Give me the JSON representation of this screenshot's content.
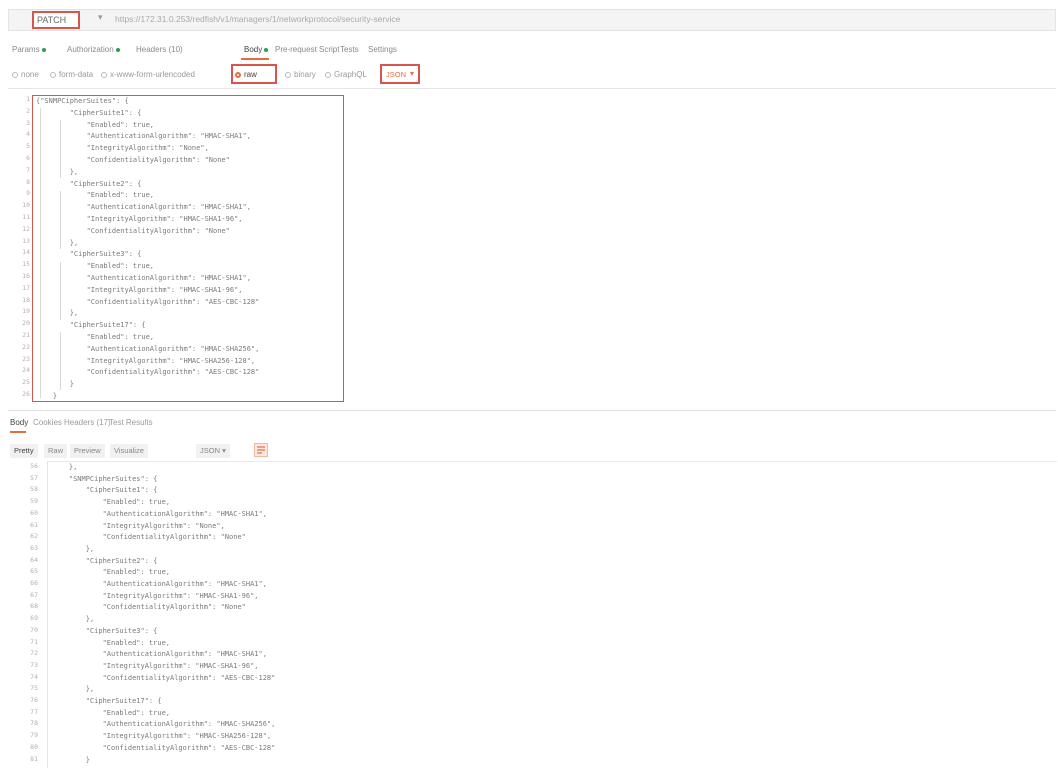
{
  "request": {
    "method": "PATCH",
    "url": "https://172.31.0.253/redfish/v1/managers/1/networkprotocol/security-service"
  },
  "tabs": [
    {
      "label": "Params",
      "dot": true
    },
    {
      "label": "Authorization",
      "dot": true
    },
    {
      "label": "Headers (10)",
      "dot": false
    },
    {
      "label": "Body",
      "dot": true,
      "active": true
    },
    {
      "label": "Pre-request Script",
      "dot": false
    },
    {
      "label": "Tests",
      "dot": false
    },
    {
      "label": "Settings",
      "dot": false
    }
  ],
  "body_options": [
    {
      "label": "none"
    },
    {
      "label": "form-data"
    },
    {
      "label": "x-www-form-urlencoded"
    },
    {
      "label": "raw",
      "selected": true
    },
    {
      "label": "binary"
    },
    {
      "label": "GraphQL"
    }
  ],
  "body_format": "JSON",
  "request_body": [
    "{\"SNMPCipherSuites\": {",
    "        \"CipherSuite1\": {",
    "            \"Enabled\": true,",
    "            \"AuthenticationAlgorithm\": \"HMAC-SHA1\",",
    "            \"IntegrityAlgorithm\": \"None\",",
    "            \"ConfidentialityAlgorithm\": \"None\"",
    "        },",
    "        \"CipherSuite2\": {",
    "            \"Enabled\": true,",
    "            \"AuthenticationAlgorithm\": \"HMAC-SHA1\",",
    "            \"IntegrityAlgorithm\": \"HMAC-SHA1-96\",",
    "            \"ConfidentialityAlgorithm\": \"None\"",
    "        },",
    "        \"CipherSuite3\": {",
    "            \"Enabled\": true,",
    "            \"AuthenticationAlgorithm\": \"HMAC-SHA1\",",
    "            \"IntegrityAlgorithm\": \"HMAC-SHA1-96\",",
    "            \"ConfidentialityAlgorithm\": \"AES-CBC-128\"",
    "        },",
    "        \"CipherSuite17\": {",
    "            \"Enabled\": true,",
    "            \"AuthenticationAlgorithm\": \"HMAC-SHA256\",",
    "            \"IntegrityAlgorithm\": \"HMAC-SHA256-128\",",
    "            \"ConfidentialityAlgorithm\": \"AES-CBC-128\"",
    "        }",
    "    }"
  ],
  "request_line_numbers": [
    "1",
    "2",
    "3",
    "4",
    "5",
    "6",
    "7",
    "8",
    "9",
    "10",
    "11",
    "12",
    "13",
    "14",
    "15",
    "16",
    "17",
    "18",
    "19",
    "20",
    "21",
    "22",
    "23",
    "24",
    "25",
    "26"
  ],
  "response_tabs": [
    {
      "label": "Body",
      "active": true
    },
    {
      "label": "Cookies"
    },
    {
      "label": "Headers (17)"
    },
    {
      "label": "Test Results"
    }
  ],
  "response_formats": [
    "Pretty",
    "Raw",
    "Preview",
    "Visualize"
  ],
  "response_format_selected": "JSON",
  "response_body": [
    "    },",
    "    \"SNMPCipherSuites\": {",
    "        \"CipherSuite1\": {",
    "            \"Enabled\": true,",
    "            \"AuthenticationAlgorithm\": \"HMAC-SHA1\",",
    "            \"IntegrityAlgorithm\": \"None\",",
    "            \"ConfidentialityAlgorithm\": \"None\"",
    "        },",
    "        \"CipherSuite2\": {",
    "            \"Enabled\": true,",
    "            \"AuthenticationAlgorithm\": \"HMAC-SHA1\",",
    "            \"IntegrityAlgorithm\": \"HMAC-SHA1-96\",",
    "            \"ConfidentialityAlgorithm\": \"None\"",
    "        },",
    "        \"CipherSuite3\": {",
    "            \"Enabled\": true,",
    "            \"AuthenticationAlgorithm\": \"HMAC-SHA1\",",
    "            \"IntegrityAlgorithm\": \"HMAC-SHA1-96\",",
    "            \"ConfidentialityAlgorithm\": \"AES-CBC-128\"",
    "        },",
    "        \"CipherSuite17\": {",
    "            \"Enabled\": true,",
    "            \"AuthenticationAlgorithm\": \"HMAC-SHA256\",",
    "            \"IntegrityAlgorithm\": \"HMAC-SHA256-128\",",
    "            \"ConfidentialityAlgorithm\": \"AES-CBC-128\"",
    "        }"
  ],
  "response_line_numbers": [
    "56",
    "57",
    "58",
    "59",
    "60",
    "61",
    "62",
    "63",
    "64",
    "65",
    "66",
    "67",
    "68",
    "69",
    "70",
    "71",
    "72",
    "73",
    "74",
    "75",
    "76",
    "77",
    "78",
    "79",
    "80",
    "81"
  ],
  "colors": {
    "accent": "#e76e3c",
    "highlight_box": "#d9534f",
    "status_dot": "#2e9b57"
  }
}
